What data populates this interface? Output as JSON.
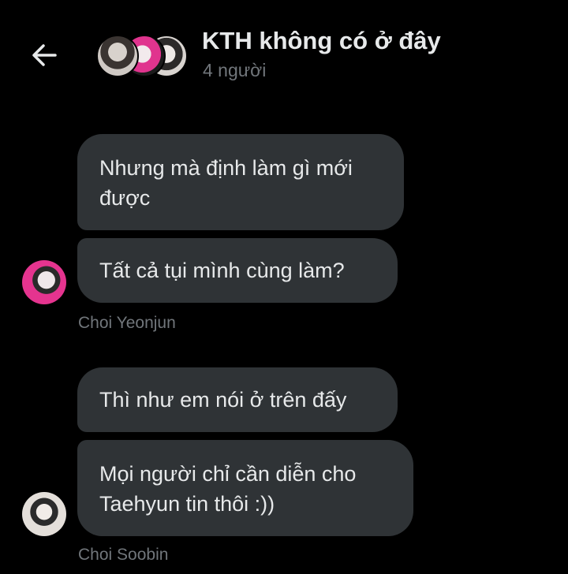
{
  "header": {
    "back_icon": "back-arrow-icon",
    "title": "KTH không có ở đây",
    "subtitle": "4 người"
  },
  "messages": [
    {
      "text": "Nhưng mà định làm gì mới được"
    },
    {
      "text": "Tất cả tụi mình cùng làm?",
      "sender": "Choi Yeonjun"
    },
    {
      "text": "Thì như em nói ở trên đấy"
    },
    {
      "text": "Mọi người chỉ cần diễn cho Taehyun tin thôi :))",
      "sender": "Choi Soobin"
    }
  ],
  "colors": {
    "background": "#000000",
    "bubble": "#2f3336",
    "text_primary": "#e7e9ea",
    "text_secondary": "#71767b"
  }
}
